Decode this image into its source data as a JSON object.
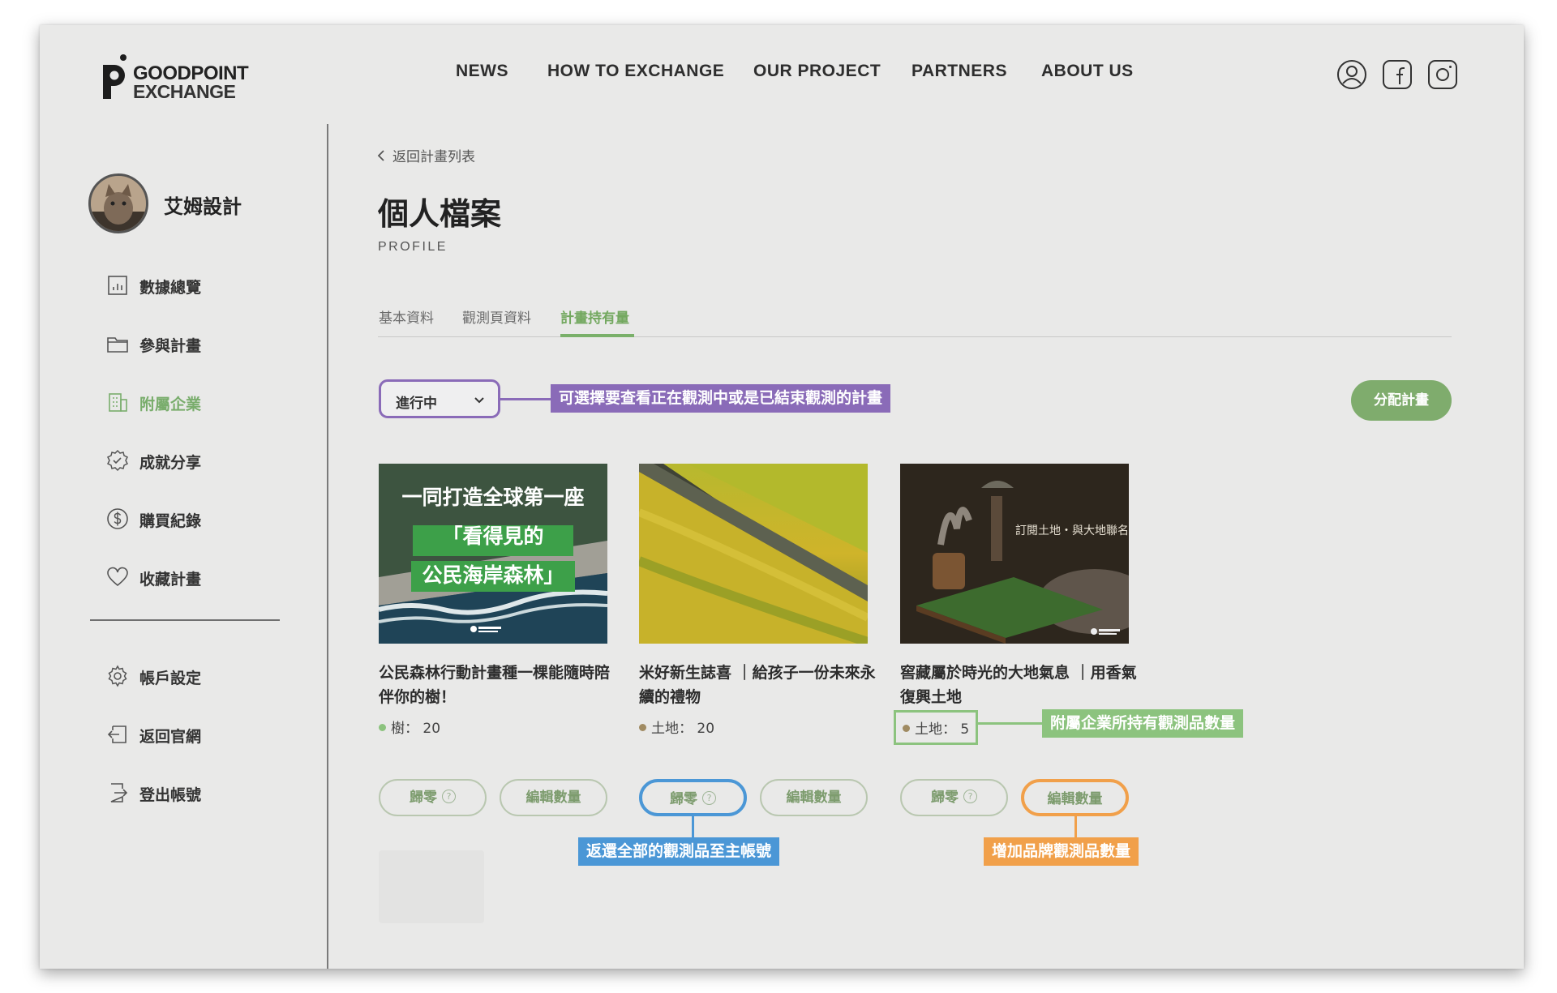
{
  "header": {
    "logo": {
      "line1": "GOODPOINT",
      "line2": "EXCHANGE"
    },
    "nav": [
      "NEWS",
      "HOW TO EXCHANGE",
      "OUR PROJECT",
      "PARTNERS",
      "ABOUT US"
    ],
    "icons": [
      "user-icon",
      "facebook-icon",
      "instagram-icon"
    ]
  },
  "sidebar": {
    "user_name": "艾姆設計",
    "items": [
      {
        "label": "數據總覽",
        "icon": "chart-icon"
      },
      {
        "label": "參與計畫",
        "icon": "folder-icon"
      },
      {
        "label": "附屬企業",
        "icon": "building-icon",
        "active": true
      },
      {
        "label": "成就分享",
        "icon": "badge-icon"
      },
      {
        "label": "購買紀錄",
        "icon": "dollar-icon"
      },
      {
        "label": "收藏計畫",
        "icon": "heart-icon"
      }
    ],
    "bottom_items": [
      {
        "label": "帳戶設定",
        "icon": "gear-icon"
      },
      {
        "label": "返回官網",
        "icon": "return-icon"
      },
      {
        "label": "登出帳號",
        "icon": "logout-icon"
      }
    ]
  },
  "main": {
    "back_link": "返回計畫列表",
    "title": "個人檔案",
    "subtitle": "PROFILE",
    "tabs": [
      {
        "label": "基本資料"
      },
      {
        "label": "觀測頁資料"
      },
      {
        "label": "計畫持有量",
        "active": true
      }
    ],
    "filter": {
      "selected": "進行中"
    },
    "assign_button": "分配計畫",
    "cards": [
      {
        "image_text": [
          "一同打造全球第一座",
          "「看得見的",
          "公民海岸森林」"
        ],
        "title": "公民森林行動計畫種一棵能隨時陪伴你的樹！",
        "qty_label": "樹：",
        "qty_value": "20",
        "zero_button": "歸零",
        "edit_button": "編輯數量"
      },
      {
        "title": "米好新生誌喜 ｜給孩子一份未來永續的禮物",
        "qty_label": "土地：",
        "qty_value": "20",
        "zero_button": "歸零",
        "edit_button": "編輯數量"
      },
      {
        "image_text": [
          "訂閱土地・與大地聯名"
        ],
        "title": "窖藏屬於時光的大地氣息 ｜用香氣復興土地",
        "qty_label": "土地：",
        "qty_value": "5",
        "zero_button": "歸零",
        "edit_button": "編輯數量"
      }
    ]
  },
  "annotations": {
    "filter_note": "可選擇要查看正在觀測中或是已結束觀測的計畫",
    "qty_note": "附屬企業所持有觀測品數量",
    "zero_note": "返還全部的觀測品至主帳號",
    "edit_note": "增加品牌觀測品數量"
  },
  "colors": {
    "accent_green": "#7fac6d",
    "purple": "#8a6bb8",
    "blue": "#4b97d6",
    "orange": "#f1a04a",
    "light_green": "#8cc37e"
  }
}
